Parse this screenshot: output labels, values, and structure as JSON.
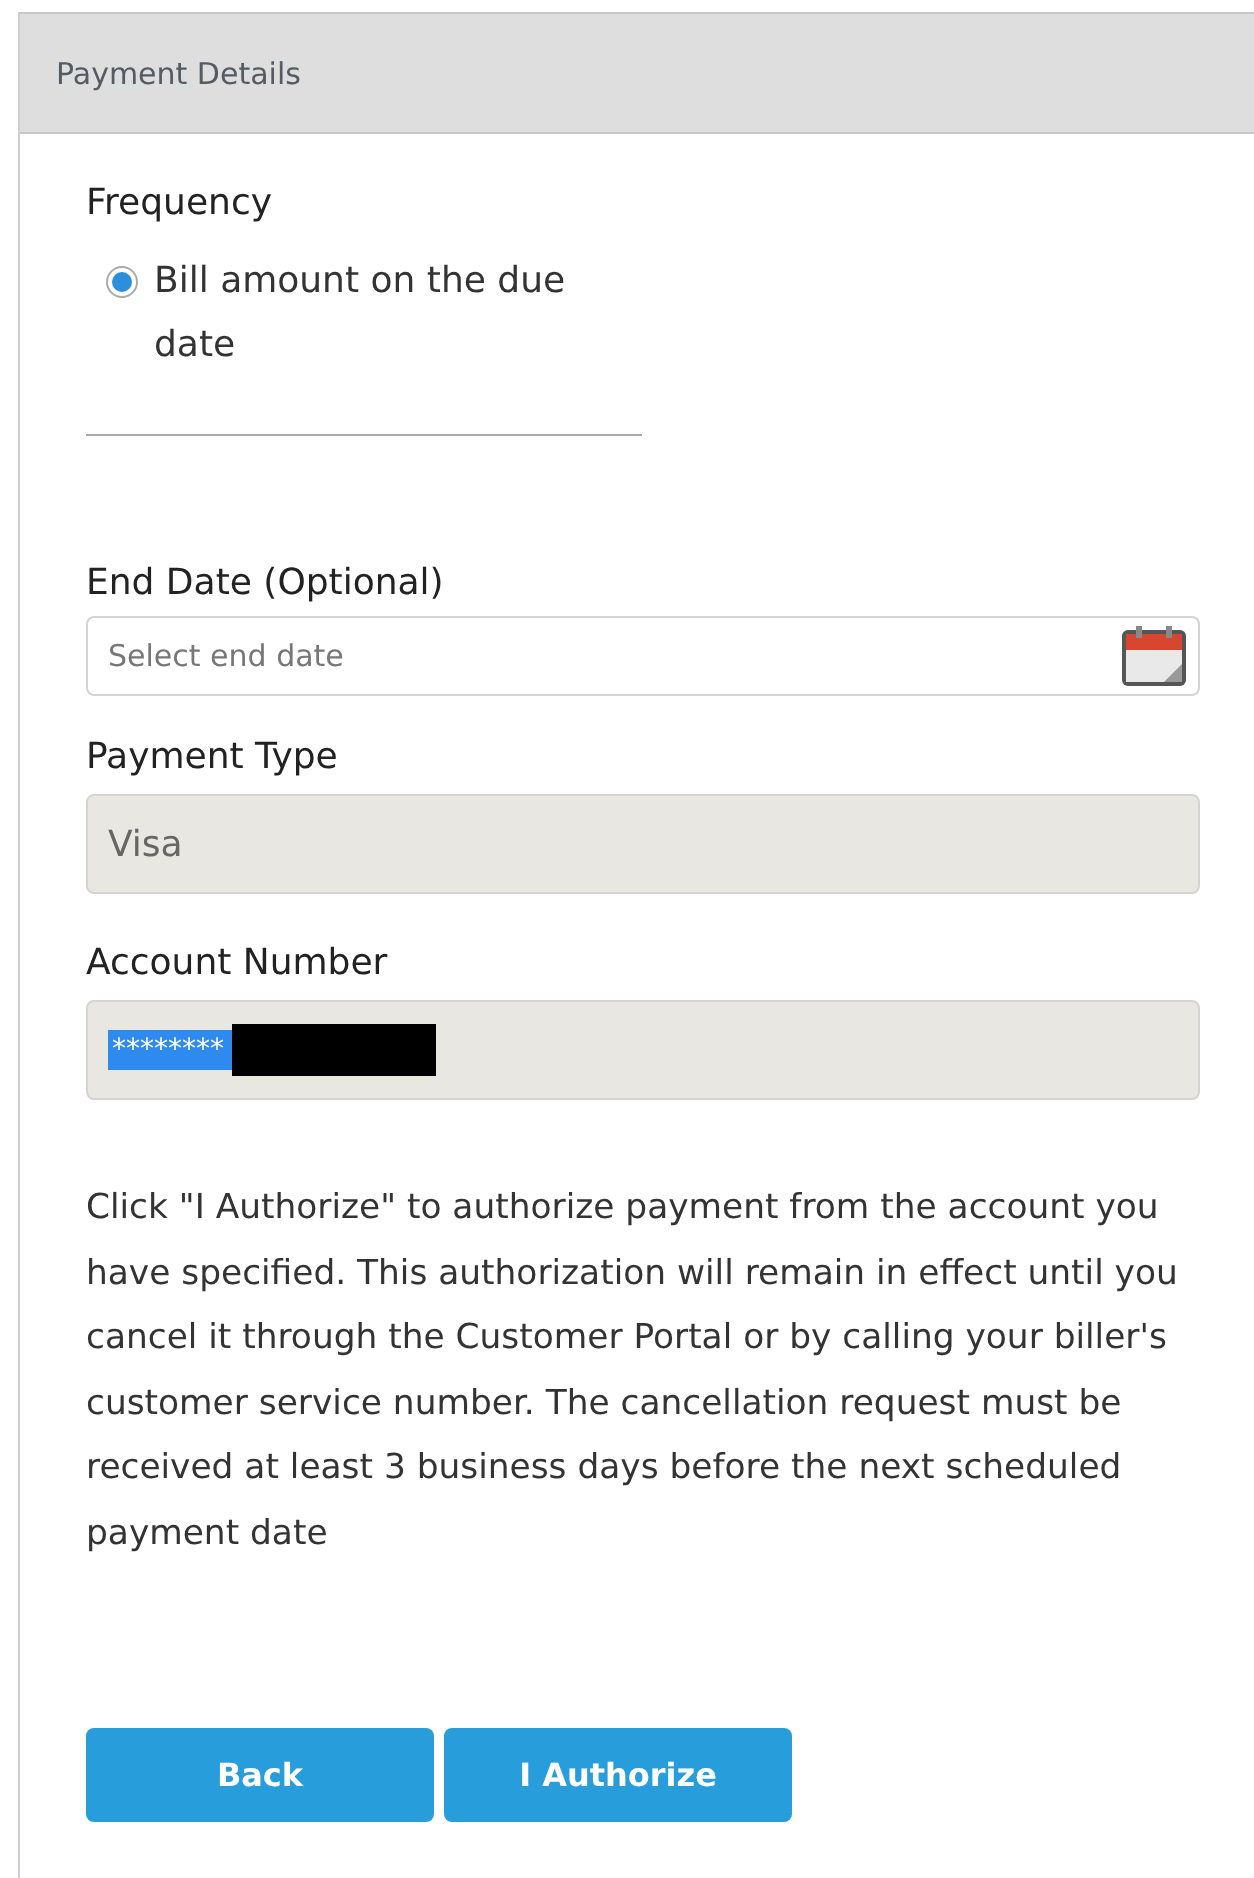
{
  "header": {
    "title": "Payment Details"
  },
  "frequency": {
    "label": "Frequency",
    "options": [
      {
        "label": "Bill amount on the due date",
        "selected": true
      }
    ]
  },
  "end_date": {
    "label": "End Date (Optional)",
    "placeholder": "Select end date"
  },
  "payment_type": {
    "label": "Payment Type",
    "value": "Visa"
  },
  "account_number": {
    "label": "Account Number",
    "value": "********",
    "text_selected": true,
    "redacted": true
  },
  "notice": "Click \"I Authorize\" to authorize payment from the account you have specified. This authorization will remain in effect until you cancel it through the Customer Portal or by calling your biller's customer service number. The cancellation request must be received at least 3 business days before the next scheduled payment date",
  "buttons": [
    "Back",
    "I Authorize"
  ]
}
